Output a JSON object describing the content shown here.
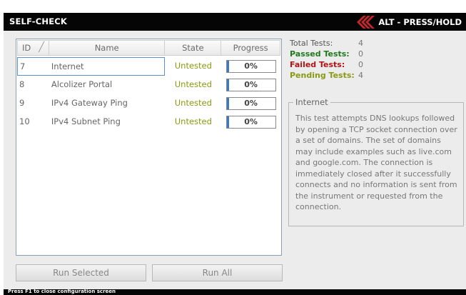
{
  "window": {
    "title": "SELF-CHECK",
    "alt_hint": "ALT - PRESS/HOLD",
    "accent_color": "#c0282d"
  },
  "table": {
    "columns": [
      "ID",
      "Name",
      "State",
      "Progress"
    ],
    "rows": [
      {
        "id": "7",
        "name": "Internet",
        "state": "Untested",
        "progress_label": "0%",
        "progress_fraction": 0.05,
        "selected": true
      },
      {
        "id": "8",
        "name": "Alcolizer Portal",
        "state": "Untested",
        "progress_label": "0%",
        "progress_fraction": 0.05,
        "selected": false
      },
      {
        "id": "9",
        "name": "IPv4 Gateway Ping",
        "state": "Untested",
        "progress_label": "0%",
        "progress_fraction": 0.05,
        "selected": false
      },
      {
        "id": "10",
        "name": "IPv4 Subnet Ping",
        "state": "Untested",
        "progress_label": "0%",
        "progress_fraction": 0.05,
        "selected": false
      }
    ]
  },
  "buttons": {
    "run_selected": "Run Selected",
    "run_all": "Run All"
  },
  "stats": {
    "total_label": "Total Tests:",
    "total_value": "4",
    "passed_label": "Passed Tests:",
    "passed_value": "0",
    "failed_label": "Failed Tests:",
    "failed_value": "0",
    "pending_label": "Pending Tests:",
    "pending_value": "4"
  },
  "details": {
    "title": "Internet",
    "description": "This test attempts DNS lookups followed by opening a TCP socket connection over a set of domains. The set of domains may include examples such as live.com and google.com. The connection is immediately closed after it successfully connects and no information is sent from the instrument or requested from the connection."
  },
  "status": {
    "text": "Press F1 to close configuration screen"
  }
}
